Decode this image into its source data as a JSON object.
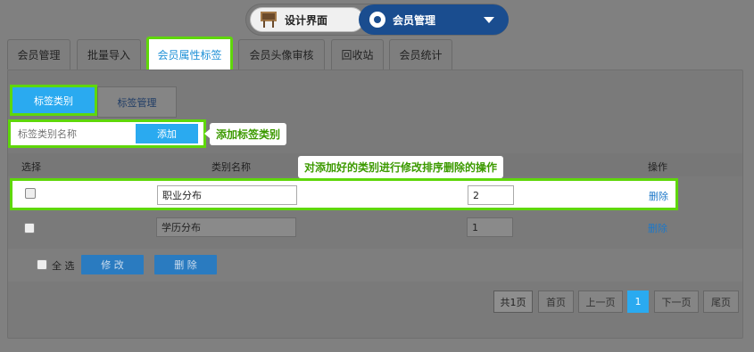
{
  "switcher": {
    "left_label": "设计界面",
    "right_label": "会员管理"
  },
  "tabs": [
    {
      "label": "会员管理"
    },
    {
      "label": "批量导入"
    },
    {
      "label": "会员属性标签"
    },
    {
      "label": "会员头像审核"
    },
    {
      "label": "回收站"
    },
    {
      "label": "会员统计"
    }
  ],
  "subtabs": [
    {
      "label": "标签类别"
    },
    {
      "label": "标签管理"
    }
  ],
  "add_form": {
    "placeholder": "标签类别名称",
    "button_label": "添加"
  },
  "callouts": {
    "add": "添加标签类别",
    "ops": "对添加好的类别进行修改排序删除的操作"
  },
  "table": {
    "headers": {
      "select": "选择",
      "name": "类别名称",
      "ops": "操作"
    },
    "rows": [
      {
        "name": "职业分布",
        "sort": "2",
        "delete": "删除"
      },
      {
        "name": "学历分布",
        "sort": "1",
        "delete": "删除"
      }
    ]
  },
  "footer": {
    "select_all": "全 选",
    "edit": "修 改",
    "delete": "删 除"
  },
  "pagination": {
    "total": "共1页",
    "first": "首页",
    "prev": "上一页",
    "current": "1",
    "next": "下一页",
    "last": "尾页"
  },
  "colors": {
    "highlight": "#5fd70a",
    "accent": "#2aaaf0",
    "callout_text": "#3c9a00"
  }
}
